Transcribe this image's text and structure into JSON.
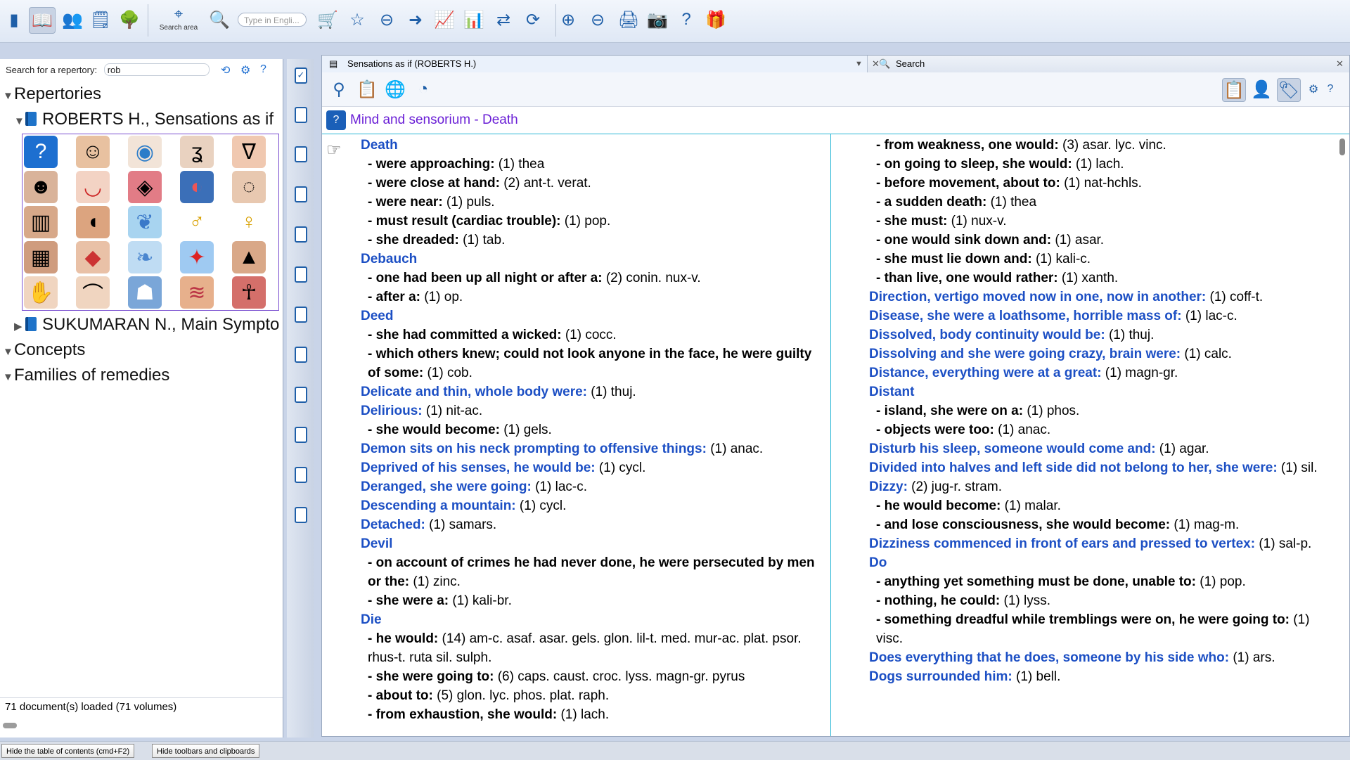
{
  "toolbar": {
    "search_area_label": "Search area",
    "type_placeholder": "Type in Engli..."
  },
  "left_panel": {
    "search_label": "Search for a repertory:",
    "search_value": "rob",
    "tree": {
      "repertories": "Repertories",
      "roberts": "ROBERTS H., Sensations as if",
      "sukumaran": "SUKUMARAN N., Main Sympto",
      "concepts": "Concepts",
      "families": "Families of remedies"
    },
    "status": "71 document(s) loaded (71 volumes)"
  },
  "tabs": {
    "doc_tab": "Sensations as if (ROBERTS H.)",
    "search_tab": "Search"
  },
  "chapter": {
    "title": "Mind and sensorium - Death"
  },
  "left_column": [
    {
      "type": "r",
      "label": "Death",
      "rest": ""
    },
    {
      "type": "s",
      "label": "- were approaching:",
      "rest": " (1) thea"
    },
    {
      "type": "s",
      "label": "- were close at hand:",
      "rest": " (2) ant-t. verat."
    },
    {
      "type": "s",
      "label": "- were near:",
      "rest": " (1) puls."
    },
    {
      "type": "s",
      "label": "- must result (cardiac trouble):",
      "rest": " (1) pop."
    },
    {
      "type": "s",
      "label": "- she dreaded:",
      "rest": " (1) tab."
    },
    {
      "type": "r",
      "label": "Debauch",
      "rest": ""
    },
    {
      "type": "s",
      "label": "- one had been up all night or after a:",
      "rest": " (2) conin. nux-v."
    },
    {
      "type": "s",
      "label": "- after a:",
      "rest": " (1) op."
    },
    {
      "type": "r",
      "label": "Deed",
      "rest": ""
    },
    {
      "type": "s",
      "label": "- she had committed a wicked:",
      "rest": " (1) cocc."
    },
    {
      "type": "sw",
      "label": "- which others knew; could not look anyone in the face, he were guilty of some:",
      "rest": " (1) cob."
    },
    {
      "type": "r",
      "label": "Delicate and thin, whole body were:",
      "rest": " (1) thuj."
    },
    {
      "type": "r",
      "label": "Delirious:",
      "rest": " (1) nit-ac."
    },
    {
      "type": "s",
      "label": "- she would become:",
      "rest": " (1) gels."
    },
    {
      "type": "r",
      "label": "Demon sits on his neck prompting to offensive things:",
      "rest": " (1) anac."
    },
    {
      "type": "r",
      "label": "Deprived of his senses, he would be:",
      "rest": " (1) cycl."
    },
    {
      "type": "r",
      "label": "Deranged, she were going:",
      "rest": " (1) lac-c."
    },
    {
      "type": "r",
      "label": "Descending a mountain:",
      "rest": " (1) cycl."
    },
    {
      "type": "r",
      "label": "Detached:",
      "rest": " (1) samars."
    },
    {
      "type": "r",
      "label": "Devil",
      "rest": ""
    },
    {
      "type": "sw",
      "label": "- on account of crimes he had never done, he were persecuted by men or the:",
      "rest": " (1) zinc."
    },
    {
      "type": "s",
      "label": "- she were a:",
      "rest": " (1) kali-br."
    },
    {
      "type": "r",
      "label": "Die",
      "rest": ""
    },
    {
      "type": "sw",
      "label": "- he would:",
      "rest": " (14) am-c. asaf. asar. gels. glon. lil-t. med. mur-ac. plat. psor. rhus-t. ruta sil. sulph."
    },
    {
      "type": "s",
      "label": "- she were going to:",
      "rest": " (6) caps. caust. croc. lyss. magn-gr. pyrus"
    },
    {
      "type": "s",
      "label": "- about to:",
      "rest": " (5) glon. lyc. phos. plat. raph."
    },
    {
      "type": "s",
      "label": "- from exhaustion, she would:",
      "rest": " (1) lach."
    }
  ],
  "right_column": [
    {
      "type": "s",
      "label": "- from weakness, one would:",
      "rest": " (3) asar. lyc. vinc."
    },
    {
      "type": "s",
      "label": "- on going to sleep, she would:",
      "rest": " (1) lach."
    },
    {
      "type": "s",
      "label": "- before movement, about to:",
      "rest": " (1) nat-hchls."
    },
    {
      "type": "s",
      "label": "- a sudden death:",
      "rest": " (1) thea"
    },
    {
      "type": "s",
      "label": "- she must:",
      "rest": " (1) nux-v."
    },
    {
      "type": "s",
      "label": "- one would sink down and:",
      "rest": " (1) asar."
    },
    {
      "type": "s",
      "label": "- she must lie down and:",
      "rest": " (1) kali-c."
    },
    {
      "type": "s",
      "label": "- than live, one would rather:",
      "rest": " (1) xanth."
    },
    {
      "type": "r",
      "label": "Direction, vertigo moved now in one, now in another:",
      "rest": " (1) coff-t."
    },
    {
      "type": "r",
      "label": "Disease, she were a loathsome, horrible mass of:",
      "rest": " (1) lac-c."
    },
    {
      "type": "r",
      "label": "Dissolved, body continuity would be:",
      "rest": " (1) thuj."
    },
    {
      "type": "r",
      "label": "Dissolving and she were going crazy, brain were:",
      "rest": " (1) calc."
    },
    {
      "type": "r",
      "label": "Distance, everything were at a great:",
      "rest": " (1) magn-gr."
    },
    {
      "type": "r",
      "label": "Distant",
      "rest": ""
    },
    {
      "type": "s",
      "label": "- island, she were on a:",
      "rest": " (1) phos."
    },
    {
      "type": "s",
      "label": "- objects were too:",
      "rest": " (1) anac."
    },
    {
      "type": "r",
      "label": "Disturb his sleep, someone would come and:",
      "rest": " (1) agar."
    },
    {
      "type": "rw",
      "label": "Divided into halves and left side did not belong to her, she were:",
      "rest": " (1) sil."
    },
    {
      "type": "r",
      "label": "Dizzy:",
      "rest": " (2) jug-r. stram."
    },
    {
      "type": "s",
      "label": "- he would become:",
      "rest": " (1) malar."
    },
    {
      "type": "s",
      "label": "- and lose consciousness, she would become:",
      "rest": " (1) mag-m."
    },
    {
      "type": "rw",
      "label": "Dizziness commenced in front of ears and pressed to vertex:",
      "rest": " (1) sal-p."
    },
    {
      "type": "r",
      "label": "Do",
      "rest": ""
    },
    {
      "type": "s",
      "label": "- anything yet something must be done, unable to:",
      "rest": " (1) pop."
    },
    {
      "type": "s",
      "label": "- nothing, he could:",
      "rest": " (1) lyss."
    },
    {
      "type": "sw",
      "label": "- something dreadful while tremblings were on, he were going to:",
      "rest": " (1) visc."
    },
    {
      "type": "r",
      "label": "Does everything that he does, someone by his side who:",
      "rest": " (1) ars."
    },
    {
      "type": "r",
      "label": "Dogs surrounded him:",
      "rest": " (1) bell."
    }
  ],
  "bottom_bar": {
    "hide_toc": "Hide the table of contents (cmd+F2)",
    "hide_toolbars": "Hide toolbars and clipboards"
  },
  "icons": [
    "book-icon",
    "open-book-icon",
    "people-icon",
    "document-icon",
    "tree-icon",
    "search-area-icon",
    "zoom-search-icon",
    "cart-icon",
    "star-icon",
    "back-icon",
    "forward-icon",
    "chart-icon",
    "bar-chart-icon",
    "export-icon",
    "copy-icon",
    "sync-icon",
    "zoom-in-icon",
    "zoom-out-icon",
    "print-icon",
    "camera-icon",
    "help-icon",
    "gift-icon",
    "binoculars-icon",
    "clipboard-cursor-icon",
    "globe-icon",
    "pie-icon",
    "settings-icon",
    "tag-icon",
    "user-icon"
  ],
  "colors": {
    "rubric": "#1c4fc4",
    "chapter": "#6a1fd6",
    "divider": "#2bb7d6"
  }
}
